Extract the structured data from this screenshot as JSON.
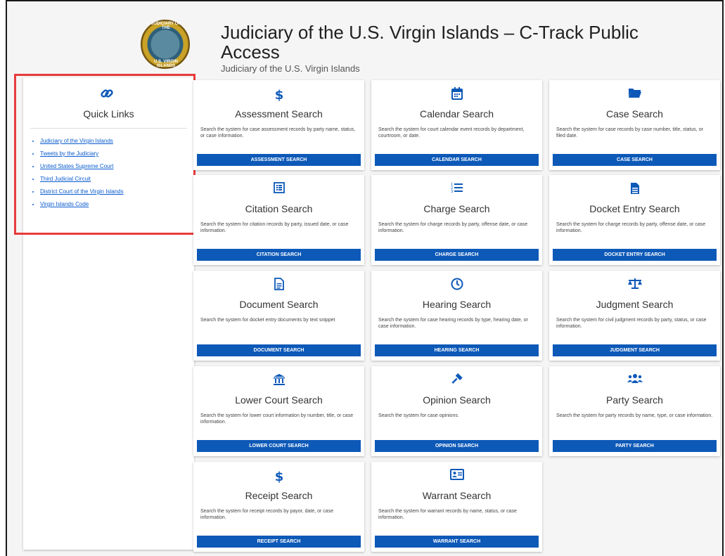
{
  "header": {
    "title": "Judiciary of the U.S. Virgin Islands – C-Track Public Access",
    "subtitle": "Judiciary of the U.S. Virgin Islands",
    "seal_top": "JUDICIARY OF THE",
    "seal_bottom": "U.S. VIRGIN ISLANDS"
  },
  "quick_links": {
    "title": "Quick Links",
    "items": [
      "Judiciary of the Virgin Islands",
      "Tweets by the Judiciary",
      "United States Supreme Court",
      "Third Judicial Circuit",
      "District Court of the Virgin Islands",
      "Virgin Islands Code"
    ]
  },
  "cards": [
    {
      "title": "Assessment Search",
      "desc": "Search the system for case assessment records by party name, status, or case information.",
      "button": "ASSESSMENT SEARCH",
      "icon": "dollar-icon"
    },
    {
      "title": "Calendar Search",
      "desc": "Search the system for court calendar event records by department, courtroom, or date.",
      "button": "CALENDAR SEARCH",
      "icon": "calendar-icon"
    },
    {
      "title": "Case Search",
      "desc": "Search the system for case records by case number, title, status, or filed date.",
      "button": "CASE SEARCH",
      "icon": "folder-icon"
    },
    {
      "title": "Citation Search",
      "desc": "Search the system for citation records by party, issued date, or case information.",
      "button": "CITATION SEARCH",
      "icon": "list-box-icon"
    },
    {
      "title": "Charge Search",
      "desc": "Search the system for charge records by party, offense date, or case information.",
      "button": "CHARGE SEARCH",
      "icon": "numbered-list-icon"
    },
    {
      "title": "Docket Entry Search",
      "desc": "Search the system for charge records by party, offense date, or case information.",
      "button": "DOCKET ENTRY SEARCH",
      "icon": "file-icon"
    },
    {
      "title": "Document Search",
      "desc": "Search the system for docket entry documents by text snippet",
      "button": "DOCUMENT SEARCH",
      "icon": "document-icon"
    },
    {
      "title": "Hearing Search",
      "desc": "Search the system for case hearing records by type, hearing date, or case information.",
      "button": "HEARING SEARCH",
      "icon": "clock-icon"
    },
    {
      "title": "Judgment Search",
      "desc": "Search the system for civil judgment records by party, status, or case information.",
      "button": "JUDGMENT SEARCH",
      "icon": "scales-icon"
    },
    {
      "title": "Lower Court Search",
      "desc": "Search the system for lower court information by number, title, or case information.",
      "button": "LOWER COURT SEARCH",
      "icon": "courthouse-icon"
    },
    {
      "title": "Opinion Search",
      "desc": "Search the system for case opinions.",
      "button": "OPINION SEARCH",
      "icon": "gavel-icon"
    },
    {
      "title": "Party Search",
      "desc": "Search the system for party records by name, type, or case information.",
      "button": "PARTY SEARCH",
      "icon": "users-icon"
    },
    {
      "title": "Receipt Search",
      "desc": "Search the system for receipt records by payor, date, or case information.",
      "button": "RECEIPT SEARCH",
      "icon": "dollar-icon"
    },
    {
      "title": "Warrant Search",
      "desc": "Search the system for warrant records by name, status, or case information.",
      "button": "WARRANT SEARCH",
      "icon": "id-card-icon"
    }
  ]
}
